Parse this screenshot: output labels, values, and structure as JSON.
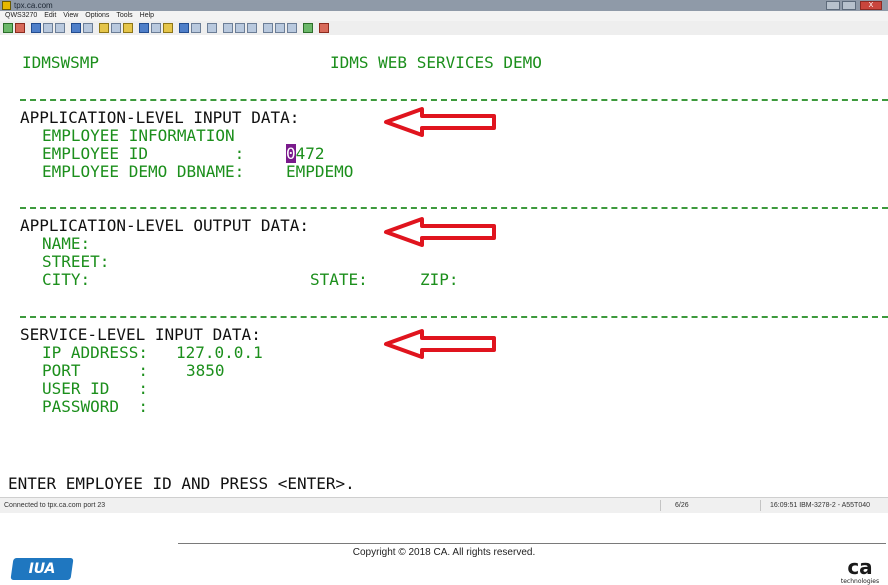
{
  "window": {
    "title": "tpx.ca.com",
    "close_label": "X"
  },
  "menu": {
    "items": [
      "QWS3270",
      "Edit",
      "View",
      "Options",
      "Tools",
      "Help"
    ]
  },
  "terminal": {
    "program_id": "IDMSWSMP",
    "screen_title": "IDMS WEB SERVICES DEMO",
    "input_section": {
      "heading": "APPLICATION-LEVEL INPUT DATA:",
      "subheading": "EMPLOYEE INFORMATION",
      "employee_id_label": "EMPLOYEE ID         :",
      "employee_id_cursor_char": "0",
      "employee_id_rest": "472",
      "dbname_label": "EMPLOYEE DEMO DBNAME:",
      "dbname_value": "EMPDEMO"
    },
    "output_section": {
      "heading": "APPLICATION-LEVEL OUTPUT DATA:",
      "name_label": "NAME:",
      "street_label": "STREET:",
      "city_label": "CITY:",
      "state_label": "STATE:",
      "zip_label": "ZIP:"
    },
    "service_section": {
      "heading": "SERVICE-LEVEL INPUT DATA:",
      "ip_label": "IP ADDRESS:",
      "ip_value": "127.0.0.1",
      "port_label": "PORT      :",
      "port_value": "3850",
      "userid_label": "USER ID   :",
      "password_label": "PASSWORD  :"
    },
    "prompt": "ENTER EMPLOYEE ID AND PRESS <ENTER>."
  },
  "statusbar": {
    "connection": "Connected to tpx.ca.com port 23",
    "cursor_pos": "6/26",
    "session_info": "16:09:51  IBM-3278-2 - A55T040"
  },
  "footer": {
    "copyright": "Copyright © 2018 CA. All rights reserved.",
    "left_logo_text": "IUA",
    "right_logo_text": "ca",
    "right_logo_sub": "technologies"
  },
  "colors": {
    "terminal_text": "#1c8f1c",
    "annotation_arrow": "#e0141e",
    "cursor": "#7a1a8c"
  }
}
